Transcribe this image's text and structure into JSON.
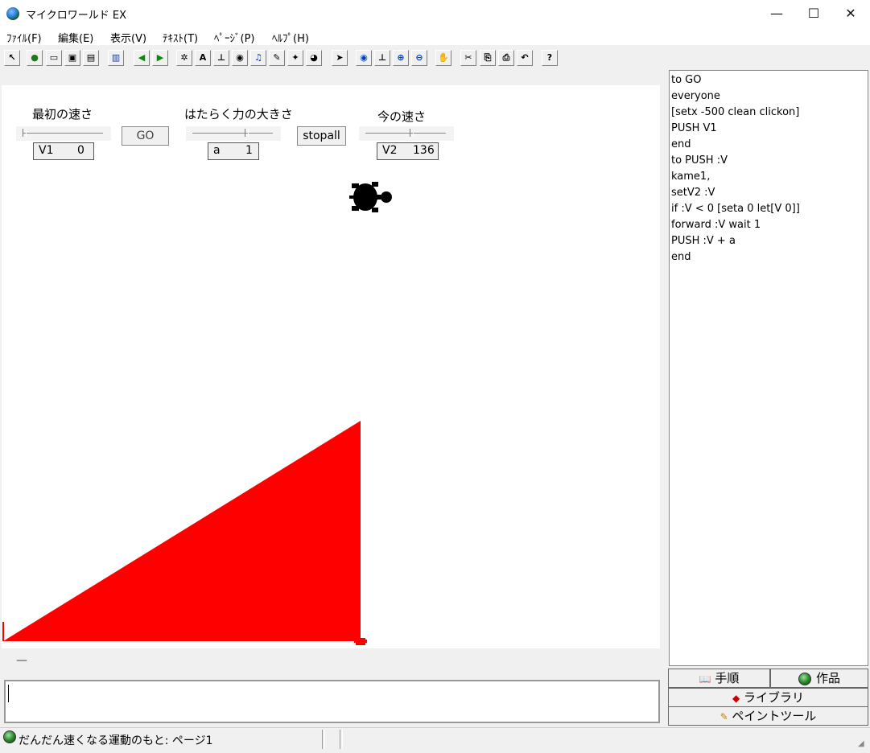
{
  "window": {
    "title": "マイクロワールド EX",
    "minimize": "—",
    "maximize": "☐",
    "close": "✕"
  },
  "menu": [
    "ﾌｧｲﾙ(F)",
    "編集(E)",
    "表示(V)",
    "ﾃｷｽﾄ(T)",
    "ﾍﾟｰｼﾞ(P)",
    "ﾍﾙﾌﾟ(H)"
  ],
  "toolbar": {
    "icons": [
      "pointer-arrow-icon",
      "globe-icon",
      "open-folder-icon",
      "save-disk-icon",
      "print-icon",
      "layout-icon",
      "back-arrow-icon",
      "forward-arrow-icon",
      "turtle-hatch-icon",
      "text-box-icon",
      "slider-tool-icon",
      "eye-tool-icon",
      "music-note-icon",
      "pencil-icon",
      "shape-icon",
      "turtle-icon",
      "select-arrow-icon",
      "eye-icon",
      "stamp-icon",
      "zoom-in-icon",
      "zoom-out-icon",
      "stop-hand-icon",
      "scissors-icon",
      "copy-icon",
      "paste-icon",
      "undo-icon",
      "help-icon"
    ],
    "text_glyphs": {
      "text-box-icon": "A",
      "help-icon": "?"
    }
  },
  "page": {
    "slider1": {
      "label": "最初の速さ",
      "var": "V1",
      "value": "0",
      "level": 0.0
    },
    "go_button": "GO",
    "slider2": {
      "label": "はたらく力の大きさ",
      "var": "a",
      "value": "1",
      "level": 0.65
    },
    "stop_button": "stopall",
    "slider3": {
      "label": "今の速さ",
      "var": "V2",
      "value": "136",
      "level": 0.55
    },
    "graph_color": "#ff0000",
    "turtle_color": "#000000"
  },
  "procedures": [
    "to GO",
    "everyone",
    "[setx -500  clean  clickon]",
    "PUSH V1",
    "end",
    "to  PUSH  :V",
    "kame1,",
    "setV2  :V",
    "if  :V  <  0  [seta  0  let[V  0]]",
    "forward  :V  wait  1",
    "PUSH  :V  +  a",
    "end"
  ],
  "tabs": {
    "procedures": "手順",
    "project": "作品",
    "library": "ライブラリ",
    "paint": "ペイントツール"
  },
  "command_center": {
    "collapse": "—",
    "text": ""
  },
  "status": {
    "project_page": "だんだん速くなる運動のもと: ページ1",
    "right": ""
  }
}
